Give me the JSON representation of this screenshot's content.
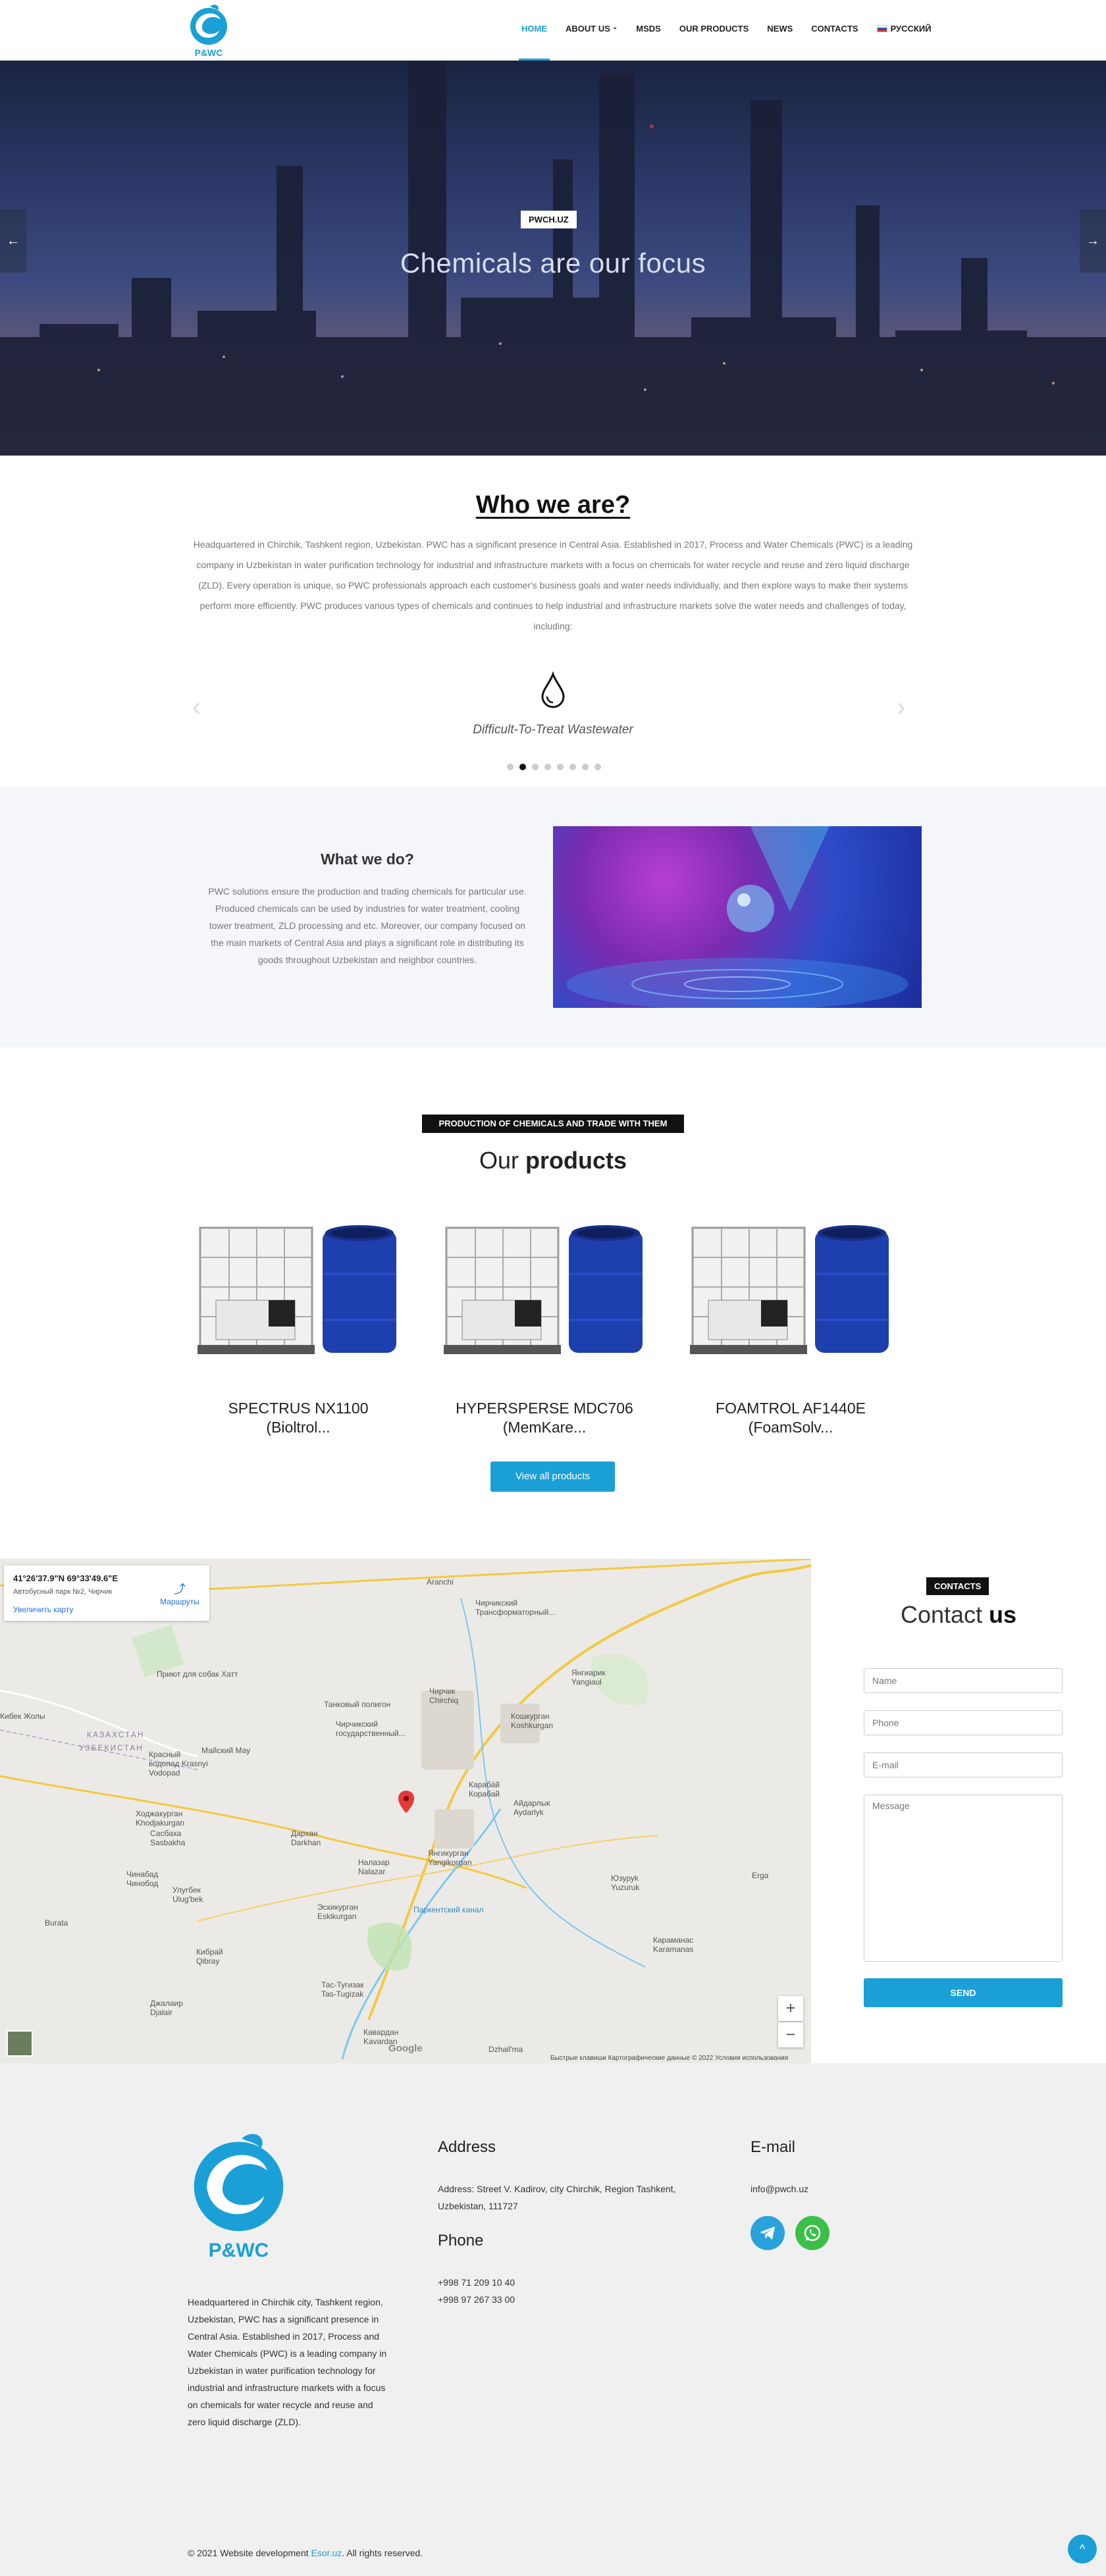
{
  "header": {
    "logo_text": "P&WC",
    "nav": [
      {
        "label": "HOME",
        "active": true
      },
      {
        "label": "ABOUT US",
        "has_dropdown": true
      },
      {
        "label": "MSDS"
      },
      {
        "label": "OUR PRODUCTS"
      },
      {
        "label": "NEWS"
      },
      {
        "label": "CONTACTS"
      },
      {
        "label": "РУССКИЙ",
        "icon": "russia-flag-icon"
      }
    ]
  },
  "hero": {
    "tag": "PWCH.UZ",
    "title": "Chemicals are our focus",
    "prev": "←",
    "next": "→"
  },
  "who": {
    "title": "Who we are?",
    "text": "Headquartered in Chirchik, Tashkent region, Uzbekistan. PWC has a significant presence in Central Asia. Established in 2017, Process and Water Chemicals (PWC) is a leading company in Uzbekistan in water purification technology for industrial and infrastructure markets with a focus on chemicals for water recycle and reuse and zero liquid discharge (ZLD). Every operation is unique, so PWC professionals approach each customer's business goals and water needs individually, and then explore ways to make their systems perform more efficiently. PWC produces various types of chemicals and continues to help industrial and infrastructure markets solve the water needs and challenges of today, including:",
    "slide_caption": "Difficult-To-Treat Wastewater",
    "slide_icon": "water-drop-icon",
    "prev": "‹",
    "next": "›",
    "dots_count": 8,
    "active_dot": 2
  },
  "what": {
    "title": "What we do?",
    "text": "PWC solutions ensure the production and trading chemicals for particular use. Produced chemicals can be used by industries for water treatment, cooling tower treatment, ZLD processing and etc. Moreover, our company focused on the main markets of Central Asia and plays a significant role in distributing its goods throughout Uzbekistan and neighbor countries."
  },
  "products": {
    "tag": "PRODUCTION OF CHEMICALS AND TRADE WITH THEM",
    "title_light": "Our ",
    "title_bold": "products",
    "items": [
      {
        "name": "SPECTRUS NX1100 (Bioltrol..."
      },
      {
        "name": "HYPERSPERSE MDC706 (MemKare..."
      },
      {
        "name": "FOAMTROL AF1440E (FoamSolv..."
      }
    ],
    "view_all": "View all products"
  },
  "map": {
    "coords": "41°26'37.9\"N 69°33'49.6\"E",
    "sub": "Автобусный парк №2, Чирчик",
    "enlarge": "Увеличить карту",
    "routes": "Маршруты",
    "zoom_in": "+",
    "zoom_out": "−",
    "google": "Google",
    "footer_text": "Быстрые клавиши    Картографические данные © 2022    Условия использования",
    "labels": [
      "Aranchi",
      "Чирчикский Трансформаторный...",
      "Приют для собак Хатт",
      "Танковый полигон",
      "Чирчик Chirchiq",
      "Янгиарик Yangiaul",
      "Чирчикский государственный...",
      "Кошкурган Koshkurgan",
      "Кибек Жолы",
      "КАЗАХСТАН",
      "УЗБЕКИСТАН",
      "Майский Мау",
      "Красный водопад Krasnyi Vodopad",
      "Караба́й Корабай",
      "Айдарлык Aydarlyk",
      "Ходжакурган Khodjakurgan",
      "Сасбаха Sasbakha",
      "Дархан Darkhan",
      "Налазар Nalazar",
      "Янгикурган Yangikorgan",
      "Чинабад Чинобод",
      "Улугбек Ulug'bek",
      "Эскикурган Eskikurgan",
      "Паркентский канал",
      "Юзуруk Yuzuruk",
      "Erga",
      "Burata",
      "Кибрай Qibray",
      "Караманас Karamanas",
      "Тас-Тугизак Tas-Tugizak",
      "Джалаир Djalair",
      "Кавардан Kavardan",
      "Dzhail'ma"
    ]
  },
  "contact": {
    "tag": "CONTACTS",
    "title_light": "Contact ",
    "title_bold": "us",
    "name_ph": "Name",
    "phone_ph": "Phone",
    "email_ph": "E-mail",
    "message_ph": "Message",
    "send": "SEND"
  },
  "footer": {
    "logo_text": "P&WC",
    "about": "Headquartered in Chirchik city, Tashkent region, Uzbekistan, PWC has a significant presence in Central Asia. Established in 2017, Process and Water Chemicals (PWC) is a leading company in Uzbekistan in water purification technology for industrial and infrastructure markets with a focus on chemicals for water recycle and reuse and zero liquid discharge (ZLD).",
    "address_title": "Address",
    "address": "Address: Street V. Kadirov, city Chirchik, Region Tashkent, Uzbekistan, 111727",
    "phone_title": "Phone",
    "phone1": "+998 71 209 10 40",
    "phone2": "+998 97 267 33 00",
    "email_title": "E-mail",
    "email": "info@pwch.uz",
    "copyright_pre": "© 2021 Website development ",
    "copyright_link": "Esor.uz",
    "copyright_post": ". All rights reserved.",
    "to_top": "^"
  },
  "colors": {
    "accent": "#1aa0d6",
    "dark": "#111111",
    "section_bg": "#f4f6f9",
    "footer_bg": "#f0f0f0",
    "telegram": "#2aa3dc",
    "whatsapp": "#3cbf4a"
  }
}
